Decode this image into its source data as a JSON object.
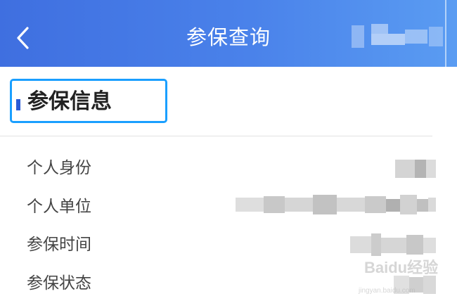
{
  "header": {
    "title": "参保查询",
    "back_icon": "chevron-left-icon",
    "background": "#4a82ea"
  },
  "section": {
    "title": "参保信息",
    "highlight_color": "#1a9fff",
    "marker_color": "#2a5bd7"
  },
  "rows": [
    {
      "label": "个人身份"
    },
    {
      "label": "个人单位"
    },
    {
      "label": "参保时间"
    },
    {
      "label": "参保状态"
    }
  ],
  "watermark": {
    "brand": "Baidu经验",
    "url": "jingyan.baidu.com"
  }
}
